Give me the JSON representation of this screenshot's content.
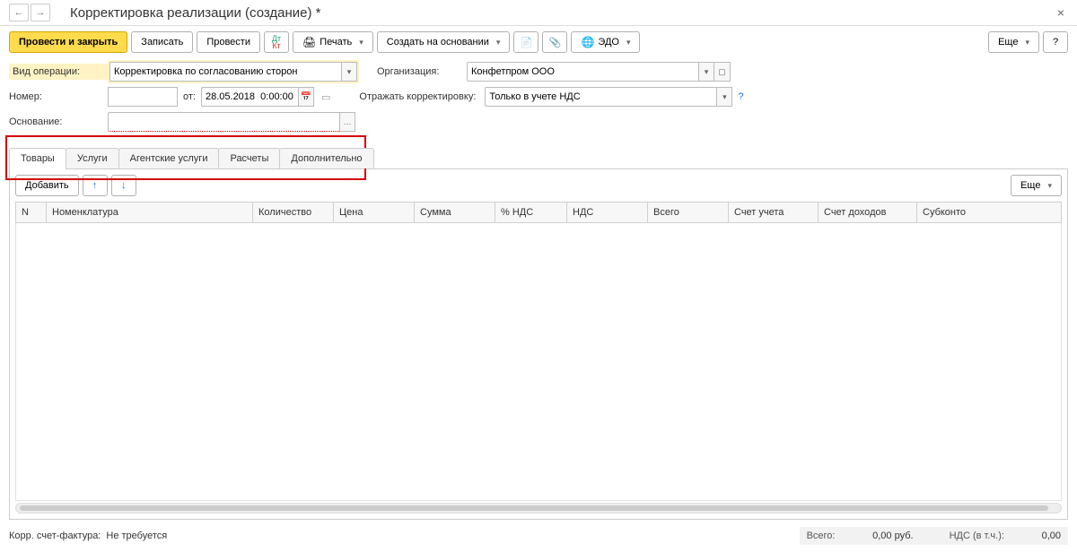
{
  "header": {
    "title": "Корректировка реализации (создание) *"
  },
  "toolbar": {
    "post_close": "Провести и закрыть",
    "save": "Записать",
    "post": "Провести",
    "print": "Печать",
    "create_based": "Создать на основании",
    "edo": "ЭДО",
    "more": "Еще"
  },
  "form": {
    "op_type_label": "Вид операции:",
    "op_type_value": "Корректировка по согласованию сторон",
    "number_label": "Номер:",
    "number_value": "",
    "from_label": "от:",
    "date_value": "28.05.2018  0:00:00",
    "basis_label": "Основание:",
    "basis_value": "",
    "org_label": "Организация:",
    "org_value": "Конфетпром ООО",
    "reflect_label": "Отражать корректировку:",
    "reflect_value": "Только в учете НДС"
  },
  "tabs": {
    "items": [
      "Товары",
      "Услуги",
      "Агентские услуги",
      "Расчеты",
      "Дополнительно"
    ],
    "active": 0
  },
  "table": {
    "add": "Добавить",
    "more": "Еще",
    "columns": [
      "N",
      "Номенклатура",
      "Количество",
      "Цена",
      "Сумма",
      "% НДС",
      "НДС",
      "Всего",
      "Счет учета",
      "Счет доходов",
      "Субконто"
    ]
  },
  "footer": {
    "invoice_label": "Корр. счет-фактура:",
    "invoice_value": "Не требуется",
    "total_label": "Всего:",
    "total_value": "0,00",
    "currency": "руб.",
    "vat_label": "НДС (в т.ч.):",
    "vat_value": "0,00"
  }
}
